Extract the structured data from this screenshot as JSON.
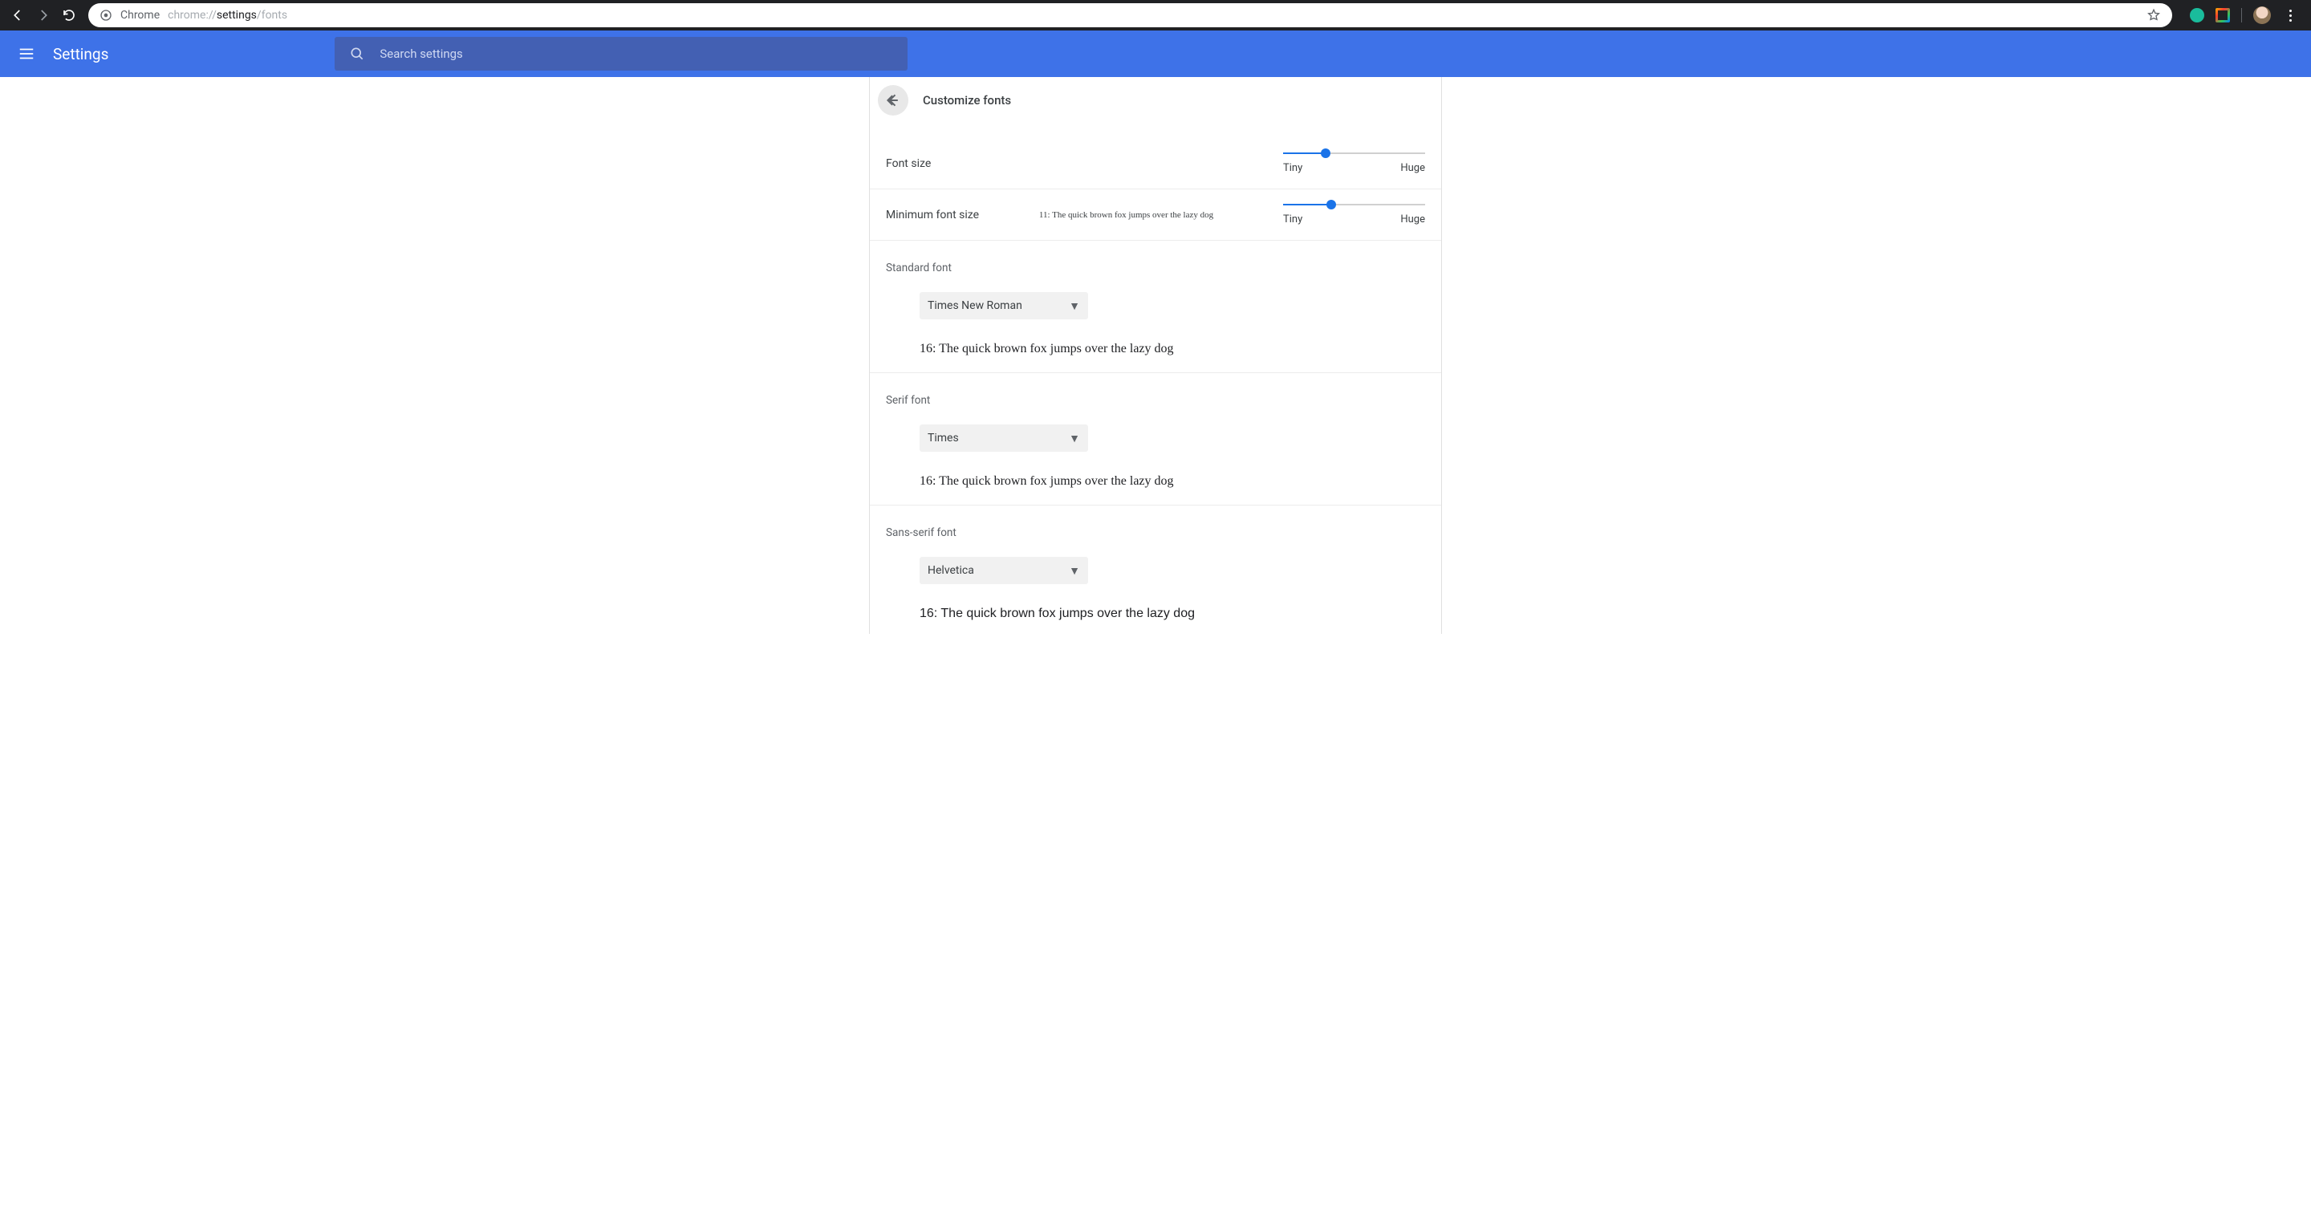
{
  "browser": {
    "site_label": "Chrome",
    "url_prefix": "chrome://",
    "url_bold": "settings",
    "url_suffix": "/fonts"
  },
  "header": {
    "title": "Settings",
    "search_placeholder": "Search settings"
  },
  "page": {
    "title": "Customize fonts",
    "font_size": {
      "label": "Font size",
      "min_label": "Tiny",
      "max_label": "Huge",
      "percent": 30
    },
    "min_font_size": {
      "label": "Minimum font size",
      "min_label": "Tiny",
      "max_label": "Huge",
      "percent": 34,
      "preview": "11: The quick brown fox jumps over the lazy dog"
    },
    "standard_font": {
      "label": "Standard font",
      "value": "Times New Roman",
      "preview": "16: The quick brown fox jumps over the lazy dog"
    },
    "serif_font": {
      "label": "Serif font",
      "value": "Times",
      "preview": "16: The quick brown fox jumps over the lazy dog"
    },
    "sans_serif_font": {
      "label": "Sans-serif font",
      "value": "Helvetica",
      "preview": "16: The quick brown fox jumps over the lazy dog"
    }
  }
}
